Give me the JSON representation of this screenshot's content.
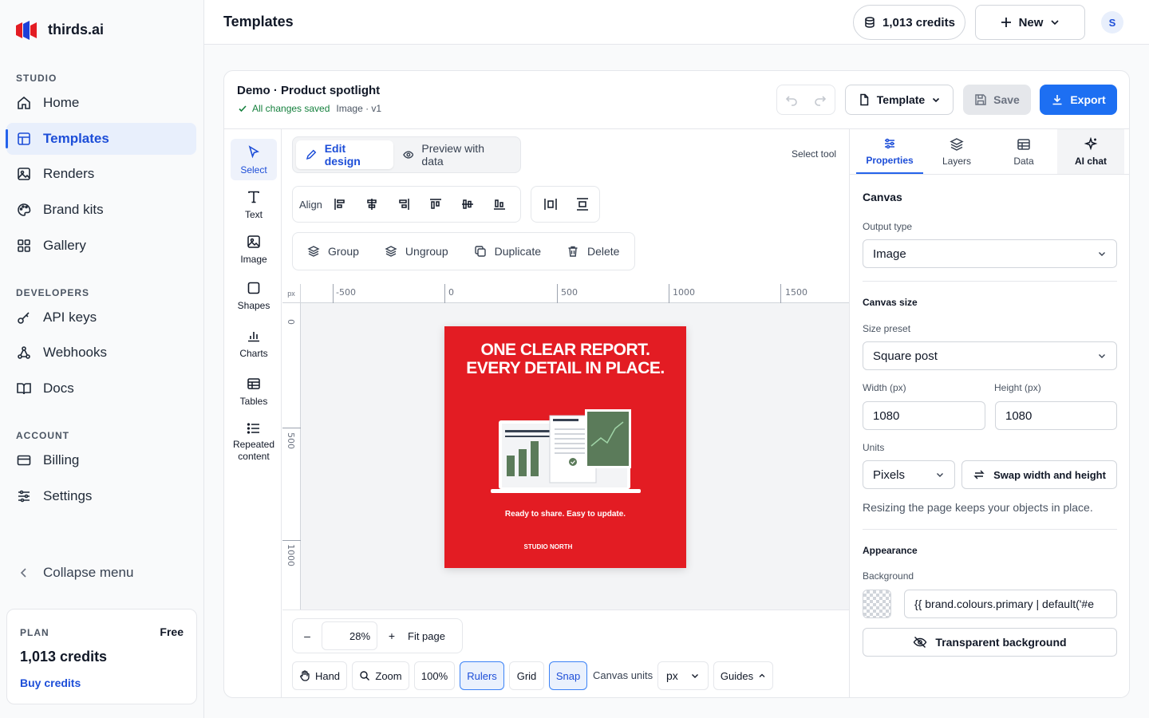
{
  "brand": {
    "name": "thirds.ai"
  },
  "sidebar": {
    "sections": [
      {
        "label": "STUDIO",
        "items": [
          {
            "label": "Home",
            "icon": "home-icon"
          },
          {
            "label": "Templates",
            "icon": "templates-icon",
            "active": true
          },
          {
            "label": "Renders",
            "icon": "image-icon"
          },
          {
            "label": "Brand kits",
            "icon": "palette-icon"
          },
          {
            "label": "Gallery",
            "icon": "grid-icon"
          }
        ]
      },
      {
        "label": "DEVELOPERS",
        "items": [
          {
            "label": "API keys",
            "icon": "key-icon"
          },
          {
            "label": "Webhooks",
            "icon": "webhook-icon"
          },
          {
            "label": "Docs",
            "icon": "book-icon"
          }
        ]
      },
      {
        "label": "ACCOUNT",
        "items": [
          {
            "label": "Billing",
            "icon": "card-icon"
          },
          {
            "label": "Settings",
            "icon": "sliders-icon"
          }
        ]
      }
    ],
    "collapse_label": "Collapse menu",
    "plan": {
      "label": "PLAN",
      "tier": "Free",
      "credits": "1,013 credits",
      "buy": "Buy credits"
    }
  },
  "header": {
    "title": "Templates",
    "credits": "1,013 credits",
    "new_label": "New",
    "avatar": "S"
  },
  "editor": {
    "doc_title": "Demo · Product spotlight",
    "saved_status": "All changes saved",
    "doc_meta": "Image · v1",
    "template_label": "Template",
    "save_label": "Save",
    "export_label": "Export",
    "tools": [
      {
        "label": "Select",
        "icon": "cursor-icon"
      },
      {
        "label": "Text",
        "icon": "text-icon"
      },
      {
        "label": "Image",
        "icon": "image-icon"
      },
      {
        "label": "Shapes",
        "icon": "square-icon"
      },
      {
        "label": "Charts",
        "icon": "bar-chart-icon"
      },
      {
        "label": "Tables",
        "icon": "table-icon"
      },
      {
        "label": "Repeated",
        "label2": "content",
        "icon": "list-icon"
      }
    ],
    "modes": {
      "edit": "Edit design",
      "preview": "Preview with data"
    },
    "current_tool": "Select tool",
    "align_label": "Align",
    "actions": {
      "group": "Group",
      "ungroup": "Ungroup",
      "duplicate": "Duplicate",
      "delete": "Delete"
    },
    "ruler": {
      "unit": "px",
      "h_ticks": [
        "-500",
        "0",
        "500",
        "1000",
        "1500"
      ],
      "v_ticks": [
        "0",
        "500",
        "1000"
      ]
    },
    "canvas": {
      "headline_1": "ONE CLEAR REPORT.",
      "headline_2": "EVERY DETAIL IN PLACE.",
      "tagline": "Ready to share. Easy to update.",
      "footer": "STUDIO NORTH",
      "bg_color": "#e31c23"
    },
    "zoom": {
      "minus": "–",
      "value": "28",
      "unit": "%",
      "plus": "+",
      "fit": "Fit page"
    },
    "bottom": {
      "hand": "Hand",
      "zoom": "Zoom",
      "hundred": "100%",
      "rulers": "Rulers",
      "grid": "Grid",
      "snap": "Snap",
      "canvas_units_label": "Canvas units",
      "canvas_units_value": "px",
      "guides": "Guides"
    }
  },
  "panel": {
    "tabs": [
      {
        "label": "Properties",
        "icon": "sliders-icon",
        "active": true
      },
      {
        "label": "Layers",
        "icon": "layers-icon"
      },
      {
        "label": "Data",
        "icon": "table-icon"
      },
      {
        "label": "AI chat",
        "icon": "sparkle-icon"
      }
    ],
    "canvas_heading": "Canvas",
    "output_type_label": "Output type",
    "output_type_value": "Image",
    "canvas_size_heading": "Canvas size",
    "size_preset_label": "Size preset",
    "size_preset_value": "Square post",
    "width_label": "Width (px)",
    "width_value": "1080",
    "height_label": "Height (px)",
    "height_value": "1080",
    "units_label": "Units",
    "units_value": "Pixels",
    "swap_label": "Swap width and height",
    "resize_note": "Resizing the page keeps your objects in place.",
    "appearance_heading": "Appearance",
    "background_label": "Background",
    "background_value": "{{ brand.colours.primary | default('#e",
    "transparent_label": "Transparent background"
  },
  "colors": {
    "accent": "#2563eb",
    "canvas_red": "#e31c23",
    "chart_green": "#5b7b5a"
  }
}
